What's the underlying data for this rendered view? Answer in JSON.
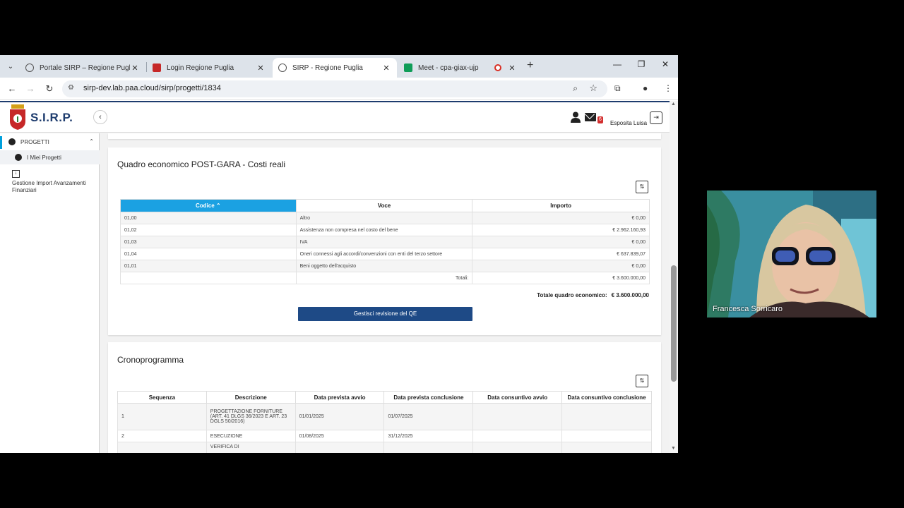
{
  "browser": {
    "tabs": [
      {
        "label": "Portale SIRP – Regione Puglia",
        "active": false
      },
      {
        "label": "Login Regione Puglia",
        "active": false
      },
      {
        "label": "SIRP - Regione Puglia",
        "active": true
      },
      {
        "label": "Meet - cpa-giax-ujp",
        "active": false
      }
    ],
    "url": "sirp-dev.lab.paa.cloud/sirp/progetti/1834"
  },
  "app": {
    "logo_text": "S.I.R.P.",
    "user_name": "Esposita Luisa",
    "mail_badge": "6"
  },
  "sidebar": {
    "section": "PROGETTI",
    "items": [
      {
        "label": "I Miei Progetti"
      },
      {
        "label": "Gestione Import Avanzamenti Finanziari"
      }
    ]
  },
  "qe": {
    "title": "Quadro economico POST-GARA - Costi reali",
    "columns": [
      "Codice",
      "Voce",
      "Importo"
    ],
    "rows": [
      {
        "codice": "01,00",
        "voce": "Altro",
        "importo": "€ 0,00"
      },
      {
        "codice": "01,02",
        "voce": "Assistenza non compresa nel costo del bene",
        "importo": "€ 2.962.160,93"
      },
      {
        "codice": "01,03",
        "voce": "IVA",
        "importo": "€ 0,00"
      },
      {
        "codice": "01,04",
        "voce": "Oneri connessi agli accordi/convenzioni con enti del terzo settore",
        "importo": "€ 637.839,07"
      },
      {
        "codice": "01,01",
        "voce": "Beni oggetto dell'acquisto",
        "importo": "€ 0,00"
      }
    ],
    "totali_label": "Totali:",
    "totali_value": "€ 3.600.000,00",
    "totale_label": "Totale quadro economico:",
    "totale_value": "€ 3.600.000,00",
    "button_label": "Gestisci revisione del QE"
  },
  "crono": {
    "title": "Cronoprogramma",
    "columns": [
      "Sequenza",
      "Descrizione",
      "Data prevista avvio",
      "Data prevista conclusione",
      "Data consuntivo avvio",
      "Data consuntivo conclusione"
    ],
    "rows": [
      {
        "seq": "1",
        "desc": "PROGETTAZIONE FORNITURE (ART. 41 DLGS 36/2023 E ART. 23 DGLS 50/2016)",
        "avvio": "01/01/2025",
        "conclusione": "01/07/2025",
        "c_avvio": "",
        "c_concl": ""
      },
      {
        "seq": "2",
        "desc": "ESECUZIONE",
        "avvio": "01/08/2025",
        "conclusione": "31/12/2025",
        "c_avvio": "",
        "c_concl": ""
      },
      {
        "seq": "",
        "desc": "VERIFICA DI",
        "avvio": "",
        "conclusione": "",
        "c_avvio": "",
        "c_concl": ""
      }
    ]
  },
  "video": {
    "participant": "Francesca Sorricaro"
  }
}
